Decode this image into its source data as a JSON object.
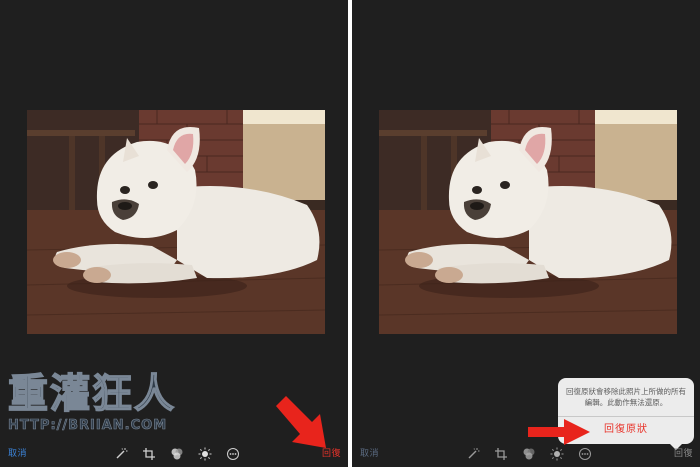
{
  "left_panel": {
    "cancel_label": "取消",
    "revert_label": "回復"
  },
  "right_panel": {
    "cancel_label": "取消",
    "revert_label": "回復",
    "revert_dialog": {
      "message": "回復原狀會移除此照片上所做的所有編輯。此動作無法還原。",
      "action_label": "回復原狀"
    }
  },
  "toolbar_icons": [
    "magic-wand-icon",
    "crop-rotate-icon",
    "filters-icon",
    "adjust-light-icon",
    "more-icon"
  ],
  "watermark": {
    "main": "重灌狂人",
    "url": "HTTP://BRIIAN.COM"
  },
  "colors": {
    "background": "#1f1f1f",
    "accent_blue": "#3b82d6",
    "accent_red": "#e8332a",
    "arrow_red": "#e8241c"
  }
}
